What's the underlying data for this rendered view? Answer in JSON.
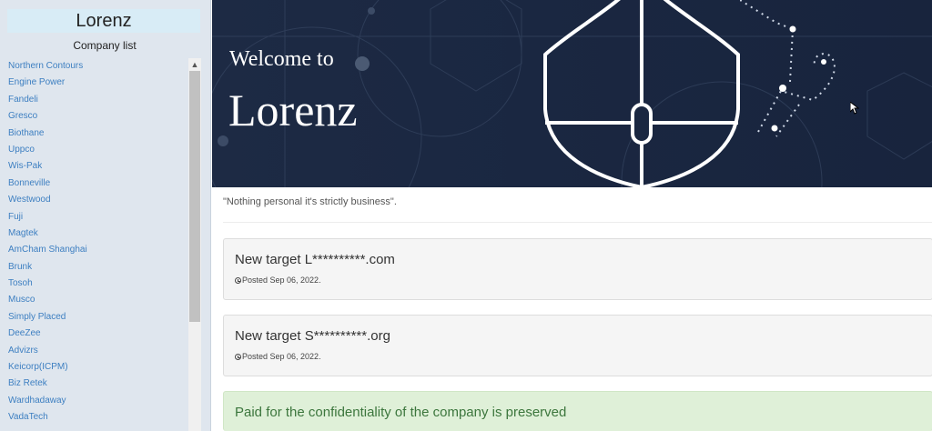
{
  "sidebar": {
    "brand": "Lorenz",
    "subtitle": "Company list",
    "companies": [
      "Northern Contours",
      "Engine Power",
      "Fandeli",
      "Gresco",
      "Biothane",
      "Uppco",
      "Wis-Pak",
      "Bonneville",
      "Westwood",
      "Fuji",
      "Magtek",
      "AmCham Shanghai",
      "Brunk",
      "Tosoh",
      "Musco",
      "Simply Placed",
      "DeeZee",
      "Advizrs",
      "Keicorp(ICPM)",
      "Biz Retek",
      "Wardhadaway",
      "VadaTech"
    ]
  },
  "hero": {
    "pre_title": "Welcome to",
    "title": "Lorenz"
  },
  "tagline": "\"Nothing personal it's strictly business\".",
  "posts": [
    {
      "title": "New target L**********.com",
      "meta": "Posted Sep 06, 2022."
    },
    {
      "title": "New target S**********.org",
      "meta": "Posted Sep 06, 2022."
    },
    {
      "title": "Paid for the confidentiality of the company is preserved",
      "meta": ""
    }
  ],
  "colors": {
    "link": "#3d7fc1",
    "hero_bg": "#1a2741",
    "success_bg": "#dff0d8",
    "success_text": "#3c763d"
  },
  "icons": [
    "shield-icon",
    "key-icon",
    "clock-icon",
    "chevron-up-icon",
    "cursor-icon"
  ]
}
